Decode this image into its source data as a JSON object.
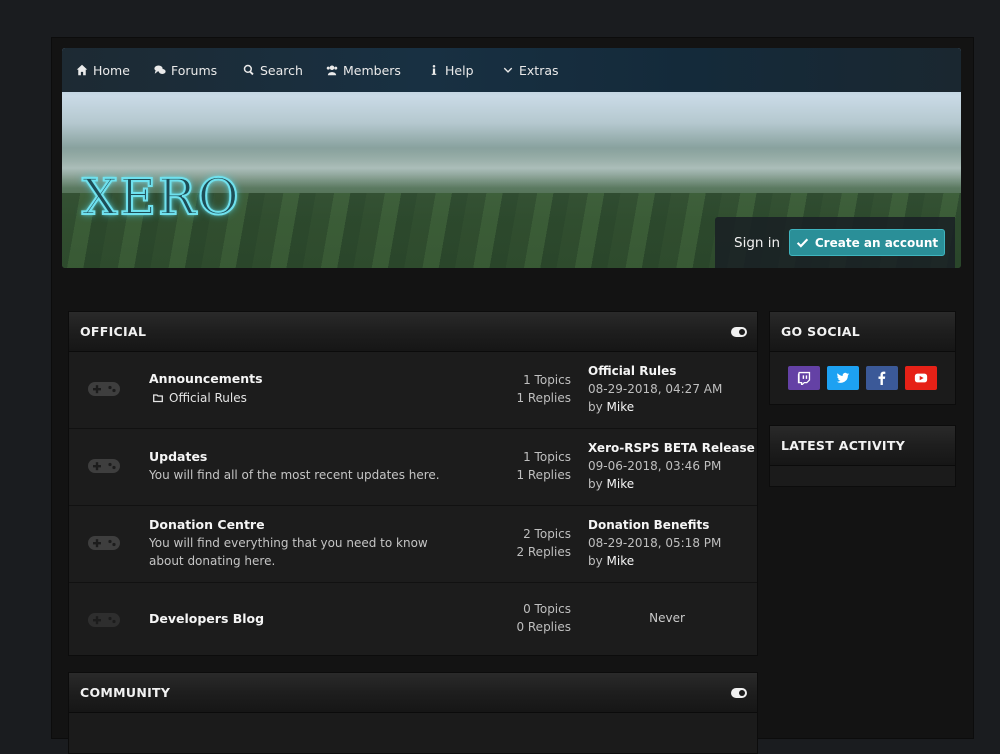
{
  "nav": {
    "home": "Home",
    "forums": "Forums",
    "search": "Search",
    "members": "Members",
    "help": "Help",
    "extras": "Extras"
  },
  "header": {
    "logo_text": "XERO",
    "sign_in": "Sign in",
    "create_account": "Create an account"
  },
  "categories": [
    {
      "title": "OFFICIAL",
      "forums": [
        {
          "name": "Announcements",
          "subforum": "Official Rules",
          "topics": "1 Topics",
          "replies": "1 Replies",
          "last_title": "Official Rules",
          "last_date": "08-29-2018, 04:27 AM",
          "last_by_prefix": "by",
          "last_by": "Mike"
        },
        {
          "name": "Updates",
          "description": "You will find all of the most recent updates here.",
          "topics": "1 Topics",
          "replies": "1 Replies",
          "last_title": "Xero-RSPS BETA Release",
          "last_date": "09-06-2018, 03:46 PM",
          "last_by_prefix": "by",
          "last_by": "Mike"
        },
        {
          "name": "Donation Centre",
          "description": "You will find everything that you need to know about donating here.",
          "topics": "2 Topics",
          "replies": "2 Replies",
          "last_title": "Donation Benefits",
          "last_date": "08-29-2018, 05:18 PM",
          "last_by_prefix": "by",
          "last_by": "Mike"
        },
        {
          "name": "Developers Blog",
          "topics": "0 Topics",
          "replies": "0 Replies",
          "last_never": "Never"
        }
      ]
    },
    {
      "title": "COMMUNITY"
    }
  ],
  "sidebar": {
    "social_title": "GO SOCIAL",
    "activity_title": "LATEST ACTIVITY",
    "social_icons": [
      "twitch-icon",
      "twitter-icon",
      "facebook-icon",
      "youtube-icon"
    ]
  },
  "colors": {
    "accent": "#2a8f98",
    "twitch": "#6441a5",
    "twitter": "#1da1f2",
    "facebook": "#3b5998",
    "youtube": "#e62117"
  }
}
